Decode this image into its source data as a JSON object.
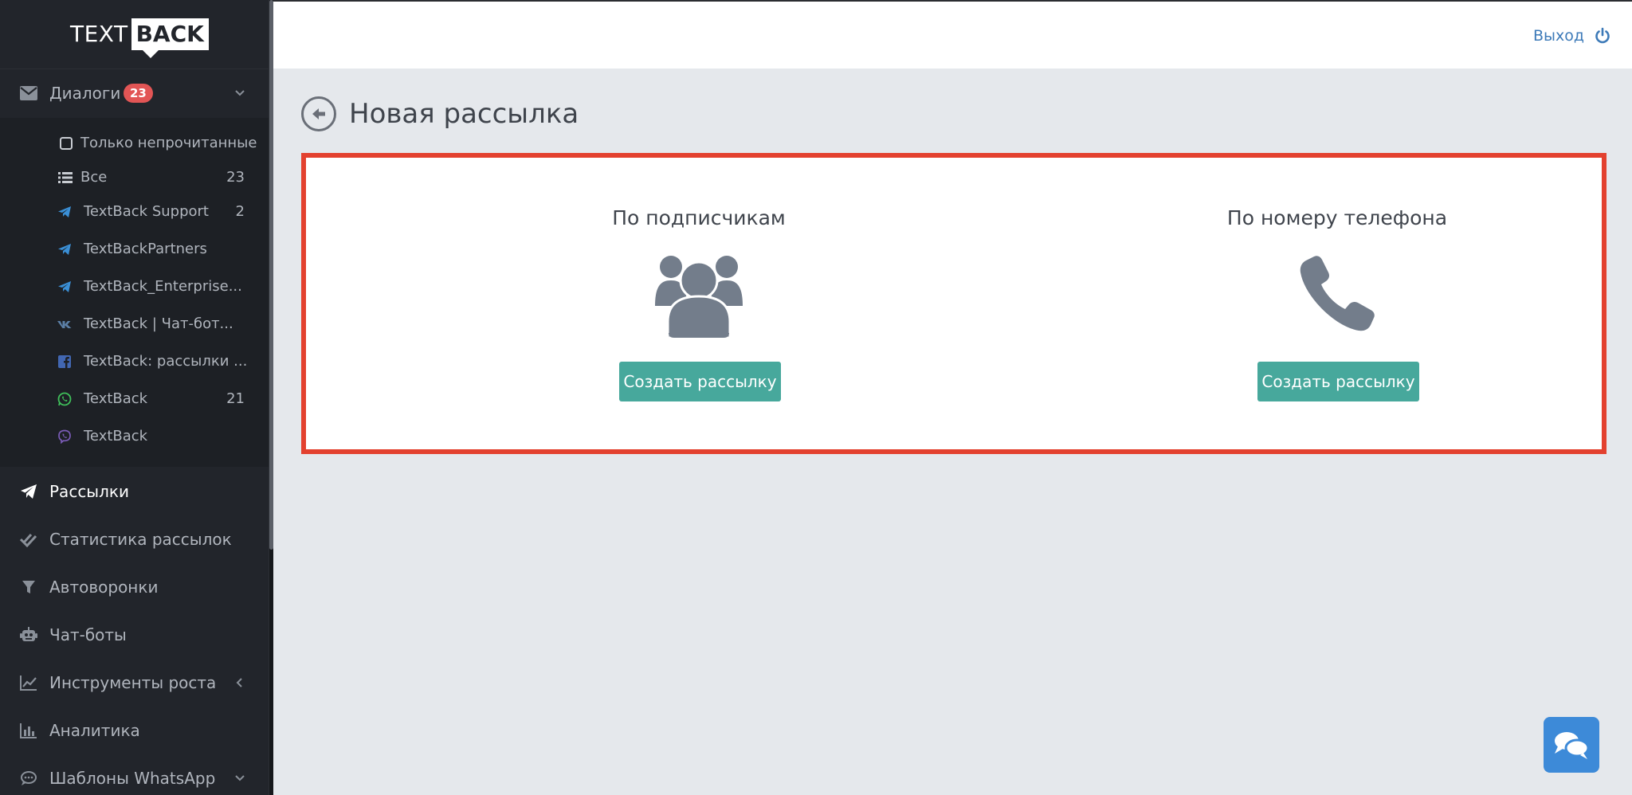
{
  "brand": {
    "logo_part1": "TEXT",
    "logo_part2": "BACK"
  },
  "header": {
    "logout_label": "Выход"
  },
  "sidebar": {
    "dialogs": {
      "label": "Диалоги",
      "badge": "23"
    },
    "subitems": [
      {
        "label": "Только непрочитанные",
        "count": "",
        "icon": "checkbox-icon"
      },
      {
        "label": "Все",
        "count": "23",
        "icon": "list-icon"
      },
      {
        "label": "TextBack Support",
        "count": "2",
        "icon": "telegram-icon"
      },
      {
        "label": "TextBackPartners",
        "count": "",
        "icon": "telegram-icon"
      },
      {
        "label": "TextBack_Enterprise...",
        "count": "",
        "icon": "telegram-icon"
      },
      {
        "label": "TextBack | Чат-бот...",
        "count": "",
        "icon": "vk-icon"
      },
      {
        "label": "TextBack: рассылки ...",
        "count": "",
        "icon": "facebook-icon"
      },
      {
        "label": "TextBack",
        "count": "21",
        "icon": "whatsapp-icon"
      },
      {
        "label": "TextBack",
        "count": "",
        "icon": "viber-icon"
      }
    ],
    "menu": [
      {
        "label": "Рассылки",
        "icon": "paper-plane-icon"
      },
      {
        "label": "Статистика рассылок",
        "icon": "double-check-icon"
      },
      {
        "label": "Автоворонки",
        "icon": "filter-icon"
      },
      {
        "label": "Чат-боты",
        "icon": "robot-icon"
      },
      {
        "label": "Инструменты роста",
        "icon": "line-chart-icon"
      },
      {
        "label": "Аналитика",
        "icon": "bar-chart-icon"
      },
      {
        "label": "Шаблоны WhatsApp",
        "icon": "speech-bubble-icon"
      }
    ]
  },
  "page": {
    "title": "Новая рассылка",
    "options": [
      {
        "title": "По подписчикам",
        "button_label": "Создать рассылку",
        "icon": "users-group-icon"
      },
      {
        "title": "По номеру телефона",
        "button_label": "Создать рассылку",
        "icon": "phone-icon"
      }
    ]
  },
  "colors": {
    "sidebar_bg": "#22252b",
    "accent_button": "#47a89c",
    "highlight_border": "#e3412f",
    "badge": "#e25555",
    "link": "#3d7ab8",
    "chat_fab": "#3d8ad8"
  }
}
